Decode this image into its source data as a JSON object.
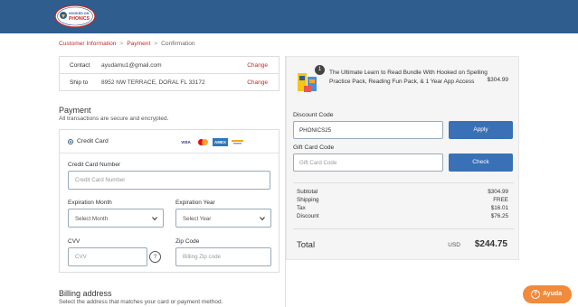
{
  "brand": {
    "logo_top": "HOOKED ON",
    "logo_bottom": "PHONICS",
    "header_color": "#2f5d8e",
    "accent_red": "#c62828",
    "button_blue": "#3a70b5",
    "help_orange": "#f08a3c"
  },
  "breadcrumb": {
    "step1": "Customer Information",
    "step2": "Payment",
    "step3": "Confirmation",
    "separator": ">"
  },
  "contact": {
    "contact_label": "Contact",
    "contact_value": "ayudamu1@gmail.com",
    "shipto_label": "Ship to",
    "shipto_value": "8952 NW TERRACE, DORAL FL 33172",
    "change_label": "Change"
  },
  "payment": {
    "title": "Payment",
    "subtitle": "All transactions are secure and encrypted.",
    "method_label": "Credit Card",
    "card_brands": [
      "VISA",
      "MASTERCARD",
      "AMEX",
      "OTHER"
    ],
    "card_number_label": "Credit Card Number",
    "card_number_placeholder": "Credit Card Number",
    "exp_month_label": "Expiration Month",
    "exp_month_value": "Select Month",
    "exp_year_label": "Expiration Year",
    "exp_year_value": "Select Year",
    "cvv_label": "CVV",
    "cvv_placeholder": "CVV",
    "cvv_help": "?",
    "zip_label": "Zip Code",
    "zip_placeholder": "Billing Zip code"
  },
  "billing": {
    "title": "Billing address",
    "subtitle": "Select the address that matches your card or payment method."
  },
  "summary": {
    "quantity": "1",
    "product_name": "The Ultimate Learn to Read Bundle With Hooked on Spelling Practice Pack, Reading Fun Pack, & 1 Year App Access",
    "product_price": "$304.99",
    "discount_label": "Discount Code",
    "discount_value": "PHONICS25",
    "apply_label": "Apply",
    "gift_label": "Gift Card Code",
    "gift_placeholder": "Gift Card Code",
    "check_label": "Check",
    "rows": [
      {
        "label": "Subtotal",
        "value": "$304.99"
      },
      {
        "label": "Shipping",
        "value": "FREE"
      },
      {
        "label": "Tax",
        "value": "$16.01"
      },
      {
        "label": "Discount",
        "value": "$76.25"
      }
    ],
    "total_label": "Total",
    "total_currency": "USD",
    "total_value": "$244.75"
  },
  "help": {
    "label": "Ayuda",
    "icon": "?"
  }
}
